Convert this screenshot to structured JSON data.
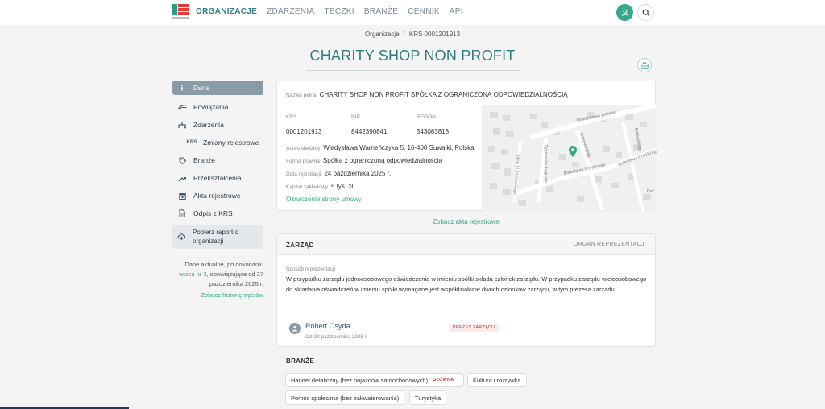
{
  "nav": {
    "items": [
      "ORGANIZACJE",
      "ZDARZENIA",
      "TECZKI",
      "BRANŻE",
      "CENNIK",
      "API"
    ],
    "active_index": 0
  },
  "breadcrumb": {
    "root": "Organizacje",
    "sep": "/",
    "current": "KRS 0001201913"
  },
  "page": {
    "title": "CHARITY SHOP NON PROFIT"
  },
  "sidebar": {
    "items": [
      {
        "label": "Dane",
        "icon": "info-icon"
      },
      {
        "label": "Powiązania",
        "icon": "network-icon"
      },
      {
        "label": "Zdarzenia",
        "icon": "events-icon"
      },
      {
        "label": "Zmiany rejestrowe",
        "icon": "krs-icon",
        "icon_text": "KRS"
      },
      {
        "label": "Branże",
        "icon": "tag-icon"
      },
      {
        "label": "Przekształcenia",
        "icon": "transform-icon"
      },
      {
        "label": "Akta rejestrowe",
        "icon": "calendar-icon"
      },
      {
        "label": "Odpis z KRS",
        "icon": "document-icon"
      }
    ],
    "report": "Pobierz raport o organizacji",
    "info_prefix": "Dane aktualne, po dokonaniu",
    "info_link": "wpisu nr 3",
    "info_middle": ", obowiązujące od",
    "info_date": "27 października 2025 r.",
    "history_link": "Zobacz historię wpisów"
  },
  "company": {
    "full_name_label": "Nazwa pełna",
    "full_name": "CHARITY SHOP NON PROFIT SPÓŁKA Z OGRANICZONĄ ODPOWIEDZIALNOŚCIĄ",
    "krs_label": "KRS",
    "krs": "0001201913",
    "nip_label": "NIP",
    "nip": "8442390841",
    "regon_label": "REGON",
    "regon": "543083818",
    "address_label": "Adres siedziby",
    "address": "Władysława Warneńczyka 5, 16-400 Suwałki, Polska",
    "form_label": "Forma prawna",
    "form": "Spółka z ograniczoną odpowiedzialnością",
    "reg_date_label": "Data rejestracji",
    "reg_date": "24 października 2025 r.",
    "capital_label": "Kapitał zakładowy",
    "capital": "5 tys. zł",
    "statute_link": "Oznaczenie strony umowy"
  },
  "map": {
    "streets": [
      "Władysława Jagiełły",
      "Grunwaldzka",
      "Bolesława Chrobrego",
      "Bolesława Chrobrego",
      "Zygmunta Augusta",
      "Jana III Sobieskiego",
      "Sobieskiego",
      "Bak"
    ]
  },
  "see_acts": "Zobacz akta rejestrowe",
  "board": {
    "title": "ZARZĄD",
    "organ": "ORGAN REPREZENTACJI",
    "rep_label": "Sposób reprezentacji",
    "rep_text": "W przypadku zarządu jednoosobowego oświadczenia w imieniu spółki składa członek zarządu. W przypadku zarządu wieloosobowego do składania oświadczeń w imieniu spółki wymagane jest współdziałanie dwóch członków zarządu, w tym prezesa zarządu.",
    "person_name": "Robert Osyda",
    "person_since": "Od 24 października 2025 r.",
    "person_role": "PREZES ZARZĄDU"
  },
  "branze": {
    "title": "BRANŻE",
    "main_badge": "GŁÓWNA",
    "items": [
      "Handel detaliczny (bez pojazdów samochodowych)",
      "Kultura i rozrywka",
      "Pomoc społeczna (bez zakwaterowania)",
      "Turystyka"
    ]
  },
  "colors": {
    "accent": "#35a88d",
    "title": "#2e7d80",
    "sidebar_active": "#8a9ba8",
    "badge_red": "#c0392b"
  }
}
